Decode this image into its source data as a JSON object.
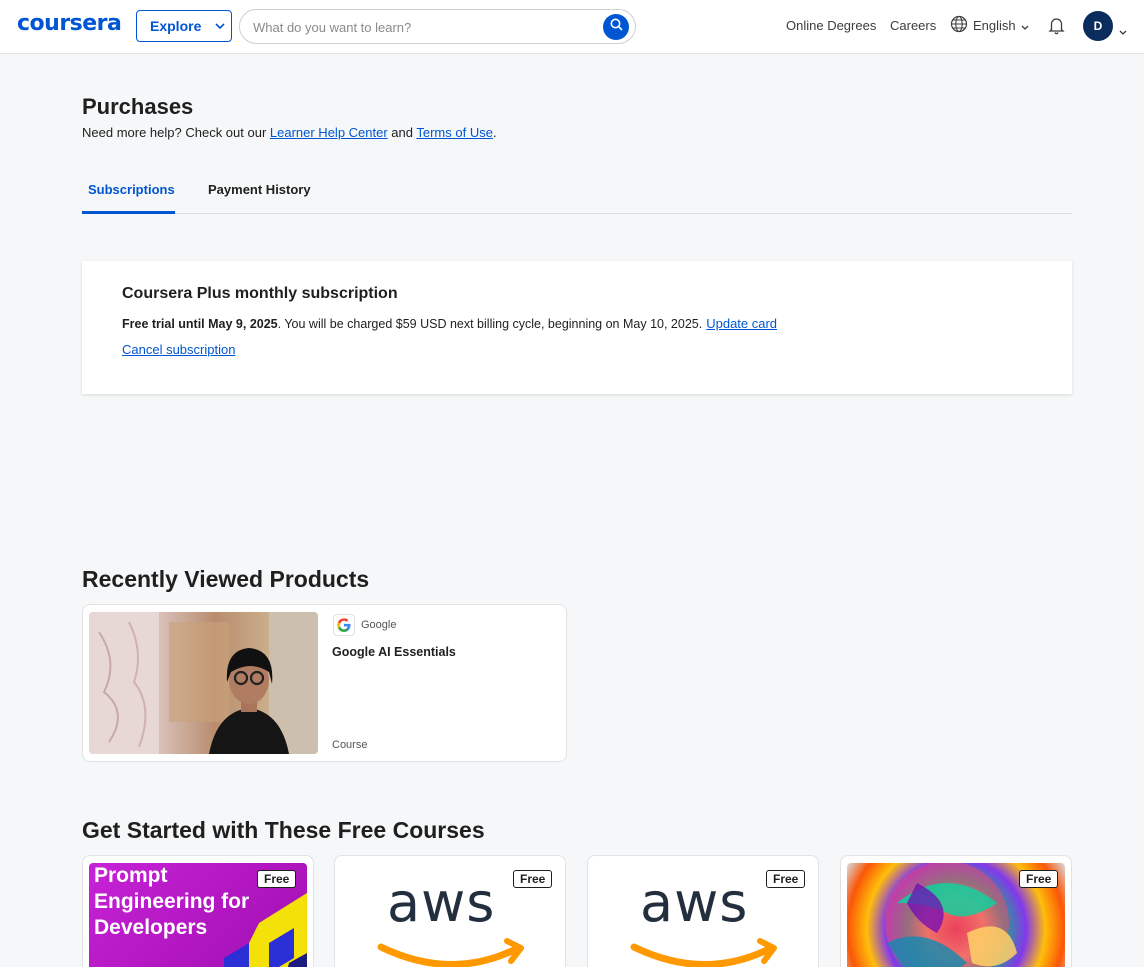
{
  "header": {
    "logo": "coursera",
    "explore_label": "Explore",
    "search_placeholder": "What do you want to learn?",
    "nav": {
      "online_degrees": "Online Degrees",
      "careers": "Careers",
      "language": "English"
    },
    "avatar_initial": "D"
  },
  "purchases": {
    "title": "Purchases",
    "help_prefix": "Need more help? Check out our ",
    "help_center_link": "Learner Help Center",
    "help_and": " and ",
    "terms_link": "Terms of Use",
    "help_suffix": ".",
    "tabs": [
      {
        "label": "Subscriptions",
        "active": true
      },
      {
        "label": "Payment History",
        "active": false
      }
    ]
  },
  "subscription": {
    "title": "Coursera Plus monthly subscription",
    "trial_bold": "Free trial until May 9, 2025",
    "charge_text": ". You will be charged $59 USD next billing cycle, beginning on May 10, 2025.",
    "update_card": "Update card",
    "cancel": "Cancel subscription"
  },
  "recently_viewed": {
    "title": "Recently Viewed Products",
    "items": [
      {
        "partner": "Google",
        "title": "Google AI Essentials",
        "type": "Course"
      }
    ]
  },
  "free_courses": {
    "title": "Get Started with These Free Courses",
    "badge": "Free",
    "items": [
      {
        "image_text": "Prompt Engineering for Developers",
        "badge": "Free"
      },
      {
        "image_text": "aws",
        "badge": "Free"
      },
      {
        "image_text": "aws",
        "badge": "Free"
      },
      {
        "image_text": "",
        "badge": "Free"
      }
    ]
  },
  "colors": {
    "brand": "#0056d2",
    "avatar": "#0b2d5e"
  }
}
